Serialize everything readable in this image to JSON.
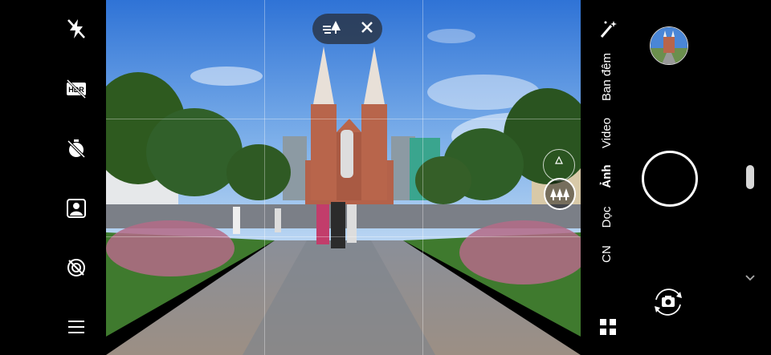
{
  "left_toolbar": {
    "icons": [
      "flash-off-icon",
      "hdr-off-icon",
      "timer-off-icon",
      "portrait-icon",
      "filter-off-icon",
      "menu-icon"
    ],
    "hdr_label": "HDR"
  },
  "viewfinder": {
    "grid": "3x3",
    "lens_switcher_icon": "wide-angle-trees-icon"
  },
  "modes": [
    {
      "label": "Ban đêm",
      "active": false
    },
    {
      "label": "Video",
      "active": false
    },
    {
      "label": "Ảnh",
      "active": true
    },
    {
      "label": "Dọc",
      "active": false
    },
    {
      "label": "CN",
      "active": false
    }
  ],
  "right_controls": {
    "beauty_icon": "magic-wand-icon",
    "shutter": "shutter-button",
    "switch_camera_icon": "switch-camera-icon",
    "apps_icon": "grid-apps-icon",
    "more_icon": "chevron-down-icon"
  },
  "colors": {
    "accent": "#ffffff",
    "background": "#000000"
  }
}
